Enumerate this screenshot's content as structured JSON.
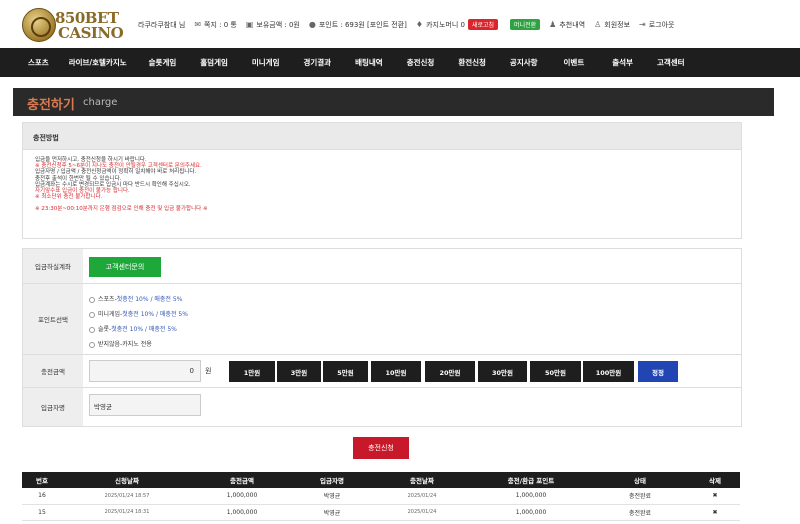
{
  "logo": {
    "top": "850BET",
    "bottom": "CASINO"
  },
  "userbar": {
    "username": "라쿠라쿠참대 님",
    "message": "쪽지 : 0 통",
    "balance": "보유금액 : 0원",
    "points": "포인트 : 693원 [포인트 전환]",
    "casino_money": "카지노머니 0",
    "refresh_badge": "새로고침",
    "mini_badge": "머니전환",
    "recommend": "추천내역",
    "member_info": "회원정보",
    "logout": "로그아웃"
  },
  "nav": [
    "스포츠",
    "라이브/호텔카지노",
    "슬롯게임",
    "홀덤게임",
    "미니게임",
    "경기결과",
    "배팅내역",
    "충전신청",
    "환전신청",
    "공지사항",
    "이벤트",
    "출석부",
    "고객센터"
  ],
  "title": {
    "ko": "충전하기",
    "en": "charge"
  },
  "notice": {
    "heading": "충전방법",
    "lines": [
      {
        "t": "입금을 먼저하시고, 충전신청을 하시기 바랍니다.",
        "c": "dark"
      },
      {
        "t": "※ 충전신청후 5~6분이 지나도 충전이 안될경우 고객센터로 문의주세요.",
        "c": "red"
      },
      {
        "t": "입금자명 / 입금액 / 충전신청금액이 정확히 일치해야 바로 처리됩니다.",
        "c": "dark"
      },
      {
        "t": "충전후 출석이 한번만 될 수 있습니다.",
        "c": "dark"
      },
      {
        "t": "입금계좌는 수시로 변경되므로 입금시 마다 반드시 확인해 주십시오.",
        "c": "dark"
      },
      {
        "t": "자기앞수표 입금이 충전이 불가능 합니다.",
        "c": "red"
      },
      {
        "t": "※ 최소단위 충전 불가합니다.",
        "c": "red"
      },
      {
        "t": "",
        "c": "dark"
      },
      {
        "t": "※ 23:30분~00:10분까지 은행 점검으로 인해 충전 및 입금 불가합니다 ※",
        "c": "red"
      }
    ]
  },
  "form": {
    "account_label": "입금하실계좌",
    "cs_button": "고객센터문의",
    "point_label": "포인트선택",
    "point_options": [
      {
        "name": "스포츠",
        "detail": "첫충전 10% / 매충전 5%"
      },
      {
        "name": "미니게임",
        "detail": "첫충전 10% / 매충전 5%"
      },
      {
        "name": "슬롯",
        "detail": "첫충전 10% / 매충전 5%"
      },
      {
        "name": "받지않음",
        "detail": "카지노 전용"
      }
    ],
    "amount_label": "충전금액",
    "amount_value": "0",
    "won": "원",
    "amount_buttons": [
      "1만원",
      "3만원",
      "5만원",
      "10만원",
      "20만원",
      "30만원",
      "50만원",
      "100만원"
    ],
    "reset_button": "정정",
    "depositor_label": "입금자명",
    "depositor_value": "박영균"
  },
  "submit": "충전신청",
  "table": {
    "headers": [
      "번호",
      "신청날짜",
      "충전금액",
      "입금자명",
      "충전날짜",
      "충전/환급 포인트",
      "상태",
      "삭제"
    ],
    "rows": [
      [
        "16",
        "2025/01/24 18:57",
        "1,000,000",
        "박영균",
        "2025/01/24",
        "1,000,000",
        "충전완료",
        "✖"
      ],
      [
        "15",
        "2025/01/24 18:31",
        "1,000,000",
        "박영균",
        "2025/01/24",
        "1,000,000",
        "충전완료",
        "✖"
      ]
    ]
  },
  "colors": {
    "accent": "#d97a52",
    "nav": "#1e1e1e",
    "green": "#1fa83a",
    "red": "#c8192a",
    "blue": "#2146b4"
  }
}
